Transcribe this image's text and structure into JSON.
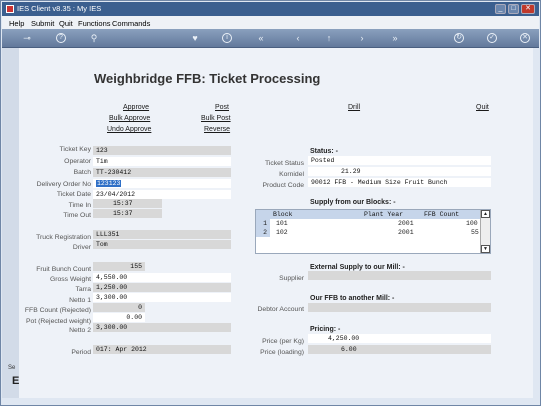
{
  "window": {
    "title": "IES Client v8.35 : My IES",
    "min": "_",
    "max": "□",
    "close": "✕"
  },
  "menu": [
    "Help",
    "Submit",
    "Quit",
    "Functions",
    "Commands"
  ],
  "toolbar_icons": [
    "key-icon",
    "help-icon",
    "search-icon",
    "heart-icon",
    "info-icon",
    "rewind-icon",
    "back-icon",
    "upload-icon",
    "forward-icon",
    "fast-forward-icon",
    "refresh-icon",
    "check-icon",
    "cancel-icon"
  ],
  "heading": "Weighbridge FFB: Ticket Processing",
  "actions": {
    "approve": "Approve",
    "bulk_approve": "Bulk Approve",
    "undo_approve": "Undo Approve",
    "post": "Post",
    "bulk_post": "Bulk Post",
    "reverse": "Reverse",
    "drill": "Drill",
    "quit": "Quit"
  },
  "ticket": {
    "key_label": "Ticket Key",
    "key": "123",
    "operator_label": "Operator",
    "operator": "Tim",
    "batch_label": "Batch",
    "batch": "TT-230412",
    "delivery_label": "Delivery Order No",
    "delivery": "123123",
    "date_label": "Ticket Date",
    "date": "23/04/2012",
    "time_in_label": "Time In",
    "time_in": "15:37",
    "time_out_label": "Time Out",
    "time_out": "15:37",
    "truck_label": "Truck Registration",
    "truck": "LLL351",
    "driver_label": "Driver",
    "driver": "Tom"
  },
  "weights": {
    "bunch_count_label": "Fruit Bunch Count",
    "bunch_count": "155",
    "gross_label": "Gross Weight",
    "gross": "4,550.00",
    "tarra_label": "Tarra",
    "tarra": "1,250.00",
    "netto1_label": "Netto 1",
    "netto1": "3,300.00",
    "rejected_count_label": "FFB Count (Rejected)",
    "rejected_count": "0",
    "pot_label": "Pot (Rejected weight)",
    "pot": "0.00",
    "netto2_label": "Netto 2",
    "netto2": "3,300.00",
    "period_label": "Period",
    "period": "017: Apr 2012"
  },
  "status": {
    "title": "Status: -",
    "ticket_status_label": "Ticket Status",
    "ticket_status": "Posted",
    "kornidel_label": "Kornidel",
    "kornidel": "21.29",
    "product_code_label": "Product Code",
    "product_code": "90012 FFB - Medium Size Fruit Bunch"
  },
  "blocks": {
    "title": "Supply from our Blocks: -",
    "columns": [
      "Block",
      "Plant Year",
      "FFB Count"
    ],
    "rows": [
      {
        "num": "1",
        "block": "101",
        "year": "2001",
        "count": "100"
      },
      {
        "num": "2",
        "block": "102",
        "year": "2001",
        "count": "55"
      }
    ],
    "scroll_up": "▲",
    "scroll_down": "▼"
  },
  "external": {
    "title": "External Supply to our Mill: -",
    "supplier_label": "Supplier",
    "supplier": ""
  },
  "to_mill": {
    "title": "Our FFB to another Mill: -",
    "debtor_label": "Debtor Account",
    "debtor": ""
  },
  "pricing": {
    "title": "Pricing: -",
    "per_kg_label": "Price (per Kg)",
    "per_kg": "4,250.00",
    "loading_label": "Price (loading)",
    "loading": "6.00"
  },
  "side": {
    "s1": "Se",
    "s2": "E"
  }
}
